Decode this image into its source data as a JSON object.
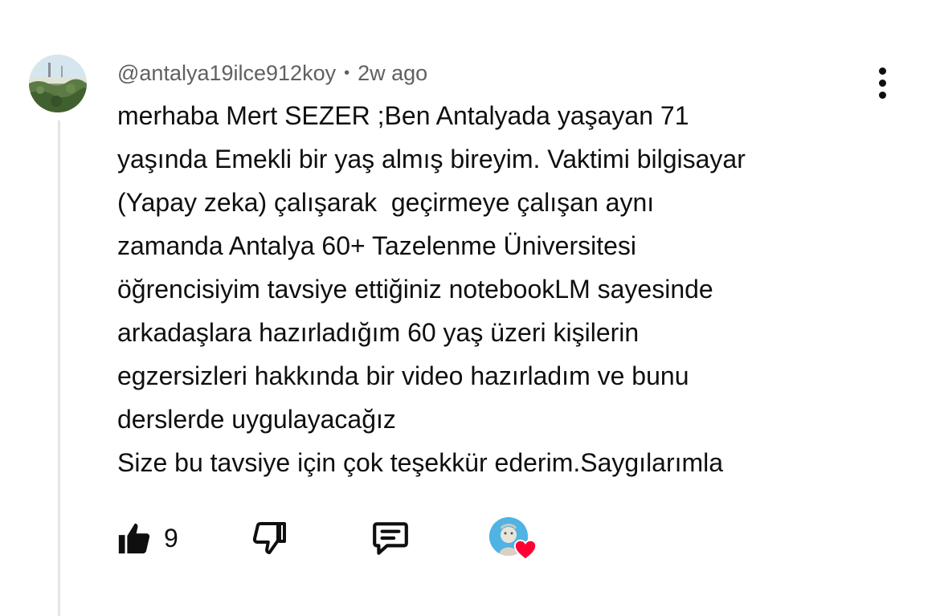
{
  "comment": {
    "author_handle": "@antalya19ilce912koy",
    "separator": "•",
    "timestamp": "2w ago",
    "lines": [
      "merhaba Mert SEZER ;Ben Antalyada yaşayan 71",
      "yaşında Emekli bir yaş almış bireyim. Vaktimi bilgisayar",
      "(Yapay zeka) çalışarak  geçirmeye çalışan aynı",
      "zamanda Antalya 60+ Tazelenme Üniversitesi",
      "öğrencisiyim tavsiye ettiğiniz notebookLM sayesinde",
      "arkadaşlara hazırladığım 60 yaş üzeri kişilerin",
      "egzersizleri hakkında bir video hazırladım ve bunu",
      "derslerde uygulayacağız",
      "Size bu tavsiye için çok teşekkür ederim.Saygılarımla"
    ]
  },
  "actions": {
    "like_count": "9",
    "icons": {
      "like": "thumbs-up-icon",
      "dislike": "thumbs-down-icon",
      "reply": "reply-comment-icon",
      "creator_heart": "creator-heart-badge",
      "more": "more-vertical-icon"
    }
  },
  "colors": {
    "text": "#0f0f0f",
    "meta": "#606060",
    "heart": "#ff0033",
    "thread_line": "#e5e5e5"
  }
}
